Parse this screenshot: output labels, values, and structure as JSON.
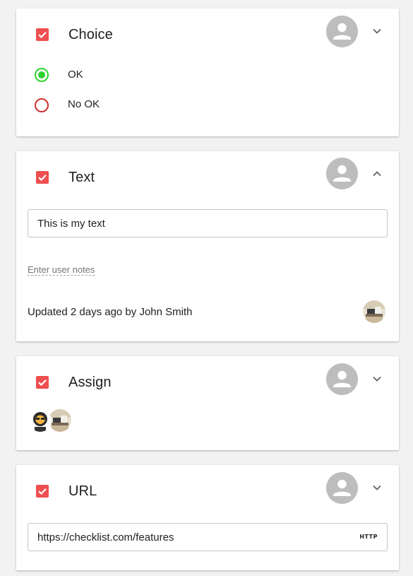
{
  "cards": {
    "choice": {
      "title": "Choice",
      "options": [
        {
          "label": "OK",
          "selected": true
        },
        {
          "label": "No OK",
          "selected": false
        }
      ],
      "expanded": false
    },
    "text": {
      "title": "Text",
      "input_value": "This is my text",
      "notes_link": "Enter user notes",
      "updated": "Updated 2 days ago by John Smith",
      "expanded": true
    },
    "assign": {
      "title": "Assign",
      "assignees": [
        "user-avatar-1",
        "user-avatar-2"
      ],
      "expanded": false
    },
    "url": {
      "title": "URL",
      "input_value": "https://checklist.com/features",
      "badge": "HTTP",
      "expanded": false
    }
  },
  "colors": {
    "checkbox": "#ef4f4f",
    "radio_selected": "#2ed32e",
    "radio_unselected": "#d32f2f",
    "avatar_placeholder": "#bdbdbd"
  },
  "icons": {
    "checkbox": "check-icon",
    "avatar": "person-icon",
    "collapse": "chevron-up-icon",
    "expand": "chevron-down-icon"
  }
}
